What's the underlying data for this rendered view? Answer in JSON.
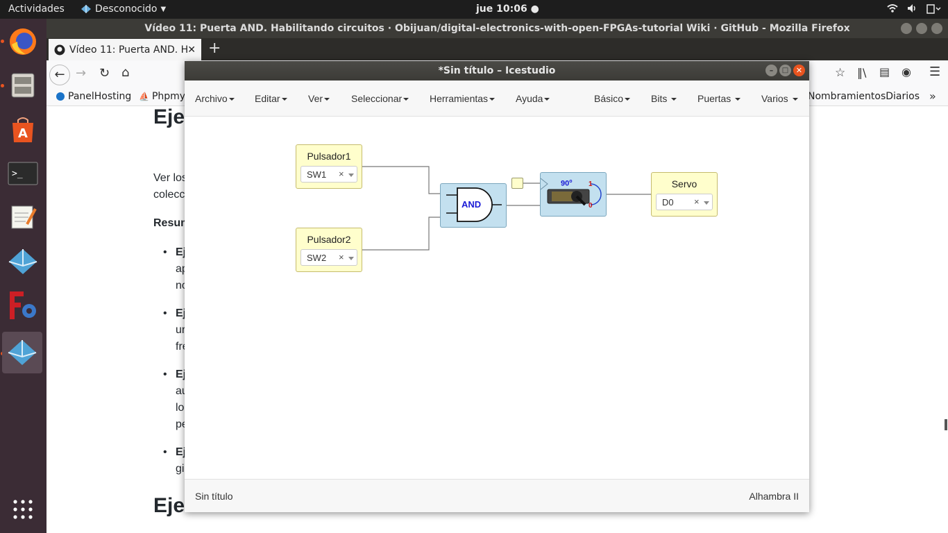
{
  "topbar": {
    "activities": "Actividades",
    "network": "Desconocido",
    "clock": "jue 10:06"
  },
  "firefox": {
    "window_title": "Vídeo 11: Puerta AND. Habilitando circuitos · Obijuan/digital-electronics-with-open-FPGAs-tutorial Wiki · GitHub - Mozilla Firefox",
    "tab_title": "Vídeo 11: Puerta AND. H",
    "bookmarks": [
      "PanelHosting",
      "Phpmy",
      "NombramientosDiarios"
    ],
    "content": {
      "heading1": "Eje",
      "para1_line1": "Ver los",
      "para1_line2": "colecc",
      "subhead": "Resum",
      "bullets": [
        {
          "bold": "Ej",
          "lines": [
            "ap",
            "no"
          ]
        },
        {
          "bold": "Ej",
          "lines": [
            "ur",
            "fre"
          ]
        },
        {
          "bold": "Ej",
          "lines": [
            "au",
            "lo",
            "pe"
          ]
        },
        {
          "bold": "Ej",
          "lines": [
            "gi"
          ]
        }
      ],
      "heading2": "Eje"
    }
  },
  "icestudio": {
    "window_title": "*Sin título – Icestudio",
    "menu": {
      "archivo": "Archivo",
      "editar": "Editar",
      "ver": "Ver",
      "seleccionar": "Seleccionar",
      "herramientas": "Herramientas",
      "ayuda": "Ayuda",
      "basico": "Básico",
      "bits": "Bits",
      "puertas": "Puertas",
      "varios": "Varios"
    },
    "blocks": {
      "pulsador1": {
        "label": "Pulsador1",
        "value": "SW1",
        "clear": "×"
      },
      "pulsador2": {
        "label": "Pulsador2",
        "value": "SW2",
        "clear": "×"
      },
      "and_gate": {
        "label": "AND"
      },
      "servo_module": {
        "angle": "90",
        "one": "1",
        "zero": "0"
      },
      "servo_output": {
        "label": "Servo",
        "value": "D0",
        "clear": "×"
      }
    },
    "status": {
      "file": "Sin título",
      "board": "Alhambra II"
    }
  }
}
